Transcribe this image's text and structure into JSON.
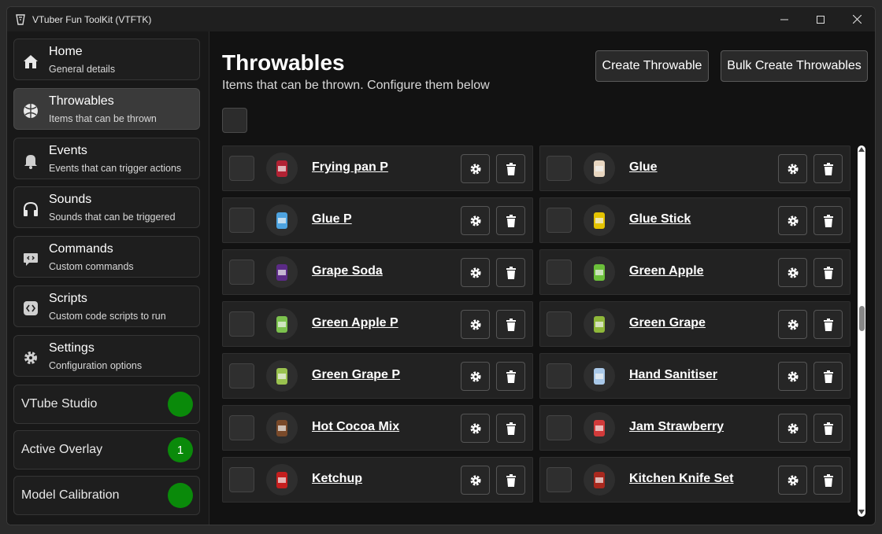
{
  "app": {
    "title": "VTuber Fun ToolKit (VTFTK)"
  },
  "sidebar": {
    "items": [
      {
        "label": "Home",
        "sub": "General details",
        "icon": "home-icon"
      },
      {
        "label": "Throwables",
        "sub": "Items that can be thrown",
        "icon": "ball-icon"
      },
      {
        "label": "Events",
        "sub": "Events that can trigger actions",
        "icon": "bell-icon"
      },
      {
        "label": "Sounds",
        "sub": "Sounds that can be triggered",
        "icon": "headphones-icon"
      },
      {
        "label": "Commands",
        "sub": "Custom commands",
        "icon": "command-icon"
      },
      {
        "label": "Scripts",
        "sub": "Custom code scripts to run",
        "icon": "code-icon"
      },
      {
        "label": "Settings",
        "sub": "Configuration options",
        "icon": "gear-icon"
      }
    ],
    "status": [
      {
        "label": "VTube Studio",
        "value": ""
      },
      {
        "label": "Active Overlay",
        "value": "1"
      },
      {
        "label": "Model Calibration",
        "value": ""
      }
    ]
  },
  "main": {
    "title": "Throwables",
    "subtitle": "Items that can be thrown. Configure them below",
    "create_label": "Create Throwable",
    "bulk_label": "Bulk Create Throwables"
  },
  "items": [
    {
      "name": "Frying pan P",
      "color": "#b22234"
    },
    {
      "name": "Glue",
      "color": "#e8d6c0"
    },
    {
      "name": "Glue P",
      "color": "#4da3e0"
    },
    {
      "name": "Glue Stick",
      "color": "#e4c300"
    },
    {
      "name": "Grape Soda",
      "color": "#5b2a86"
    },
    {
      "name": "Green Apple",
      "color": "#6bbf3a"
    },
    {
      "name": "Green Apple P",
      "color": "#7cc24e"
    },
    {
      "name": "Green Grape",
      "color": "#8fb83a"
    },
    {
      "name": "Green Grape P",
      "color": "#9ac24f"
    },
    {
      "name": "Hand Sanitiser",
      "color": "#a9c8e8"
    },
    {
      "name": "Hot Cocoa Mix",
      "color": "#7a4a2a"
    },
    {
      "name": "Jam Strawberry",
      "color": "#d23a3a"
    },
    {
      "name": "Ketchup",
      "color": "#c41e1e"
    },
    {
      "name": "Kitchen Knife Set",
      "color": "#a8281e"
    }
  ],
  "colors": {
    "status_green": "#0a8a0a",
    "window_bg": "#121212"
  }
}
